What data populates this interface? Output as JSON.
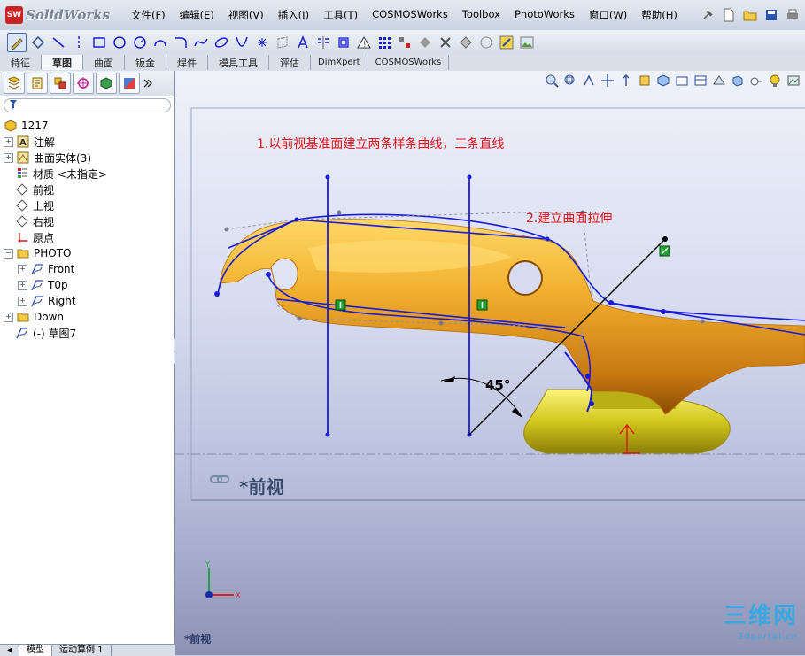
{
  "app": {
    "logo_badge": "SW",
    "logo_text": "SolidWorks"
  },
  "menu": [
    "文件(F)",
    "编辑(E)",
    "视图(V)",
    "插入(I)",
    "工具(T)",
    "COSMOSWorks",
    "Toolbox",
    "PhotoWorks",
    "窗口(W)",
    "帮助(H)"
  ],
  "command_tabs": [
    "特征",
    "草图",
    "曲面",
    "钣金",
    "焊件",
    "模具工具",
    "评估",
    "DimXpert",
    "COSMOSWorks"
  ],
  "tree": {
    "root": "1217",
    "items": [
      "注解",
      "曲面实体(3)",
      "材质 <未指定>",
      "前视",
      "上视",
      "右视",
      "原点",
      "PHOTO",
      "Front",
      "T0p",
      "Right",
      "Down",
      "(-) 草图7"
    ]
  },
  "bottom_tabs": [
    "模型",
    "运动算例 1"
  ],
  "viewport": {
    "note1": "1.以前视基准面建立两条样条曲线，三条直线",
    "note2": "2.建立曲面拉伸",
    "angle": "45°",
    "view_name": "*前视",
    "view_name_small": "*前视",
    "watermark_main": "三维网",
    "watermark_sub": "3dportal.cn"
  },
  "colors": {
    "sketch": "#1a1ad8",
    "annotation": "#e0101a",
    "body": "#e6a21e",
    "base": "#d8cf20"
  }
}
